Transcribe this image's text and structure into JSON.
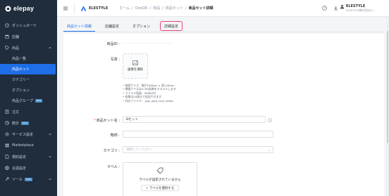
{
  "app": {
    "brand": "elepay"
  },
  "colors": {
    "sidebar_bg": "#1f2d3d",
    "accent": "#1e6ee8",
    "highlight": "#e5407a"
  },
  "sidebar": {
    "items": [
      {
        "label": "ダッシュボード",
        "icon": "clock-icon"
      },
      {
        "label": "店舗",
        "icon": "store-icon"
      },
      {
        "label": "商品",
        "icon": "tag-icon",
        "expanded": true
      },
      {
        "label": "商品一覧",
        "sub": true
      },
      {
        "label": "商品セット",
        "sub": true,
        "active": true
      },
      {
        "label": "カテゴリー",
        "sub": true
      },
      {
        "label": "オプション",
        "sub": true
      },
      {
        "label": "商品グループ",
        "sub": true,
        "badge": "beta"
      },
      {
        "label": "注文",
        "icon": "receipt-icon"
      },
      {
        "label": "統計",
        "icon": "chart-icon",
        "badge": "beta"
      },
      {
        "label": "サービス設定",
        "icon": "gear-icon"
      },
      {
        "label": "Marketplace",
        "icon": "grid-icon"
      },
      {
        "label": "規約設定",
        "icon": "doc-icon"
      },
      {
        "label": "言語設定",
        "icon": "globe-icon"
      },
      {
        "label": "ツール",
        "icon": "tool-icon",
        "badge": "beta"
      }
    ]
  },
  "header": {
    "store_name": "ELESTYLE",
    "breadcrumb": [
      "ホーム",
      "OneQR",
      "商品",
      "商品セット",
      "商品セット詳細"
    ],
    "user": {
      "name": "ELESTYLE",
      "company": "ELESTYLE株式会社(E..."
    }
  },
  "tabs": [
    {
      "label": "商品セット情報",
      "active": true
    },
    {
      "label": "店舗設定"
    },
    {
      "label": "オプション"
    },
    {
      "label": "詳細設定",
      "outlined": true
    }
  ],
  "form": {
    "product_id_label": "商品ID :",
    "product_id_value": "- - - - - - - - - - - - - - - - - - - - -",
    "photo_label": "写真 :",
    "upload_text": "画像を選択",
    "notes": [
      "推奨サイズ：幅が1600px × 高1200px",
      "横幅サイズは4:3の画像をオススメします",
      "ファイル容量：5MB以内",
      "画像は10枚まで追加できます",
      "対応ファイル：.jpg,.jpeg,.png,.webp"
    ],
    "name_label": "商品セット名 :",
    "name_value": "Bセット",
    "short_label": "略称 :",
    "short_value": "",
    "category_label": "カテゴリ :",
    "category_placeholder": "選択してください",
    "label_label": "ラベル :",
    "label_empty": "ラベルが設定されていません",
    "label_button": "+ ラベルを選択する"
  }
}
